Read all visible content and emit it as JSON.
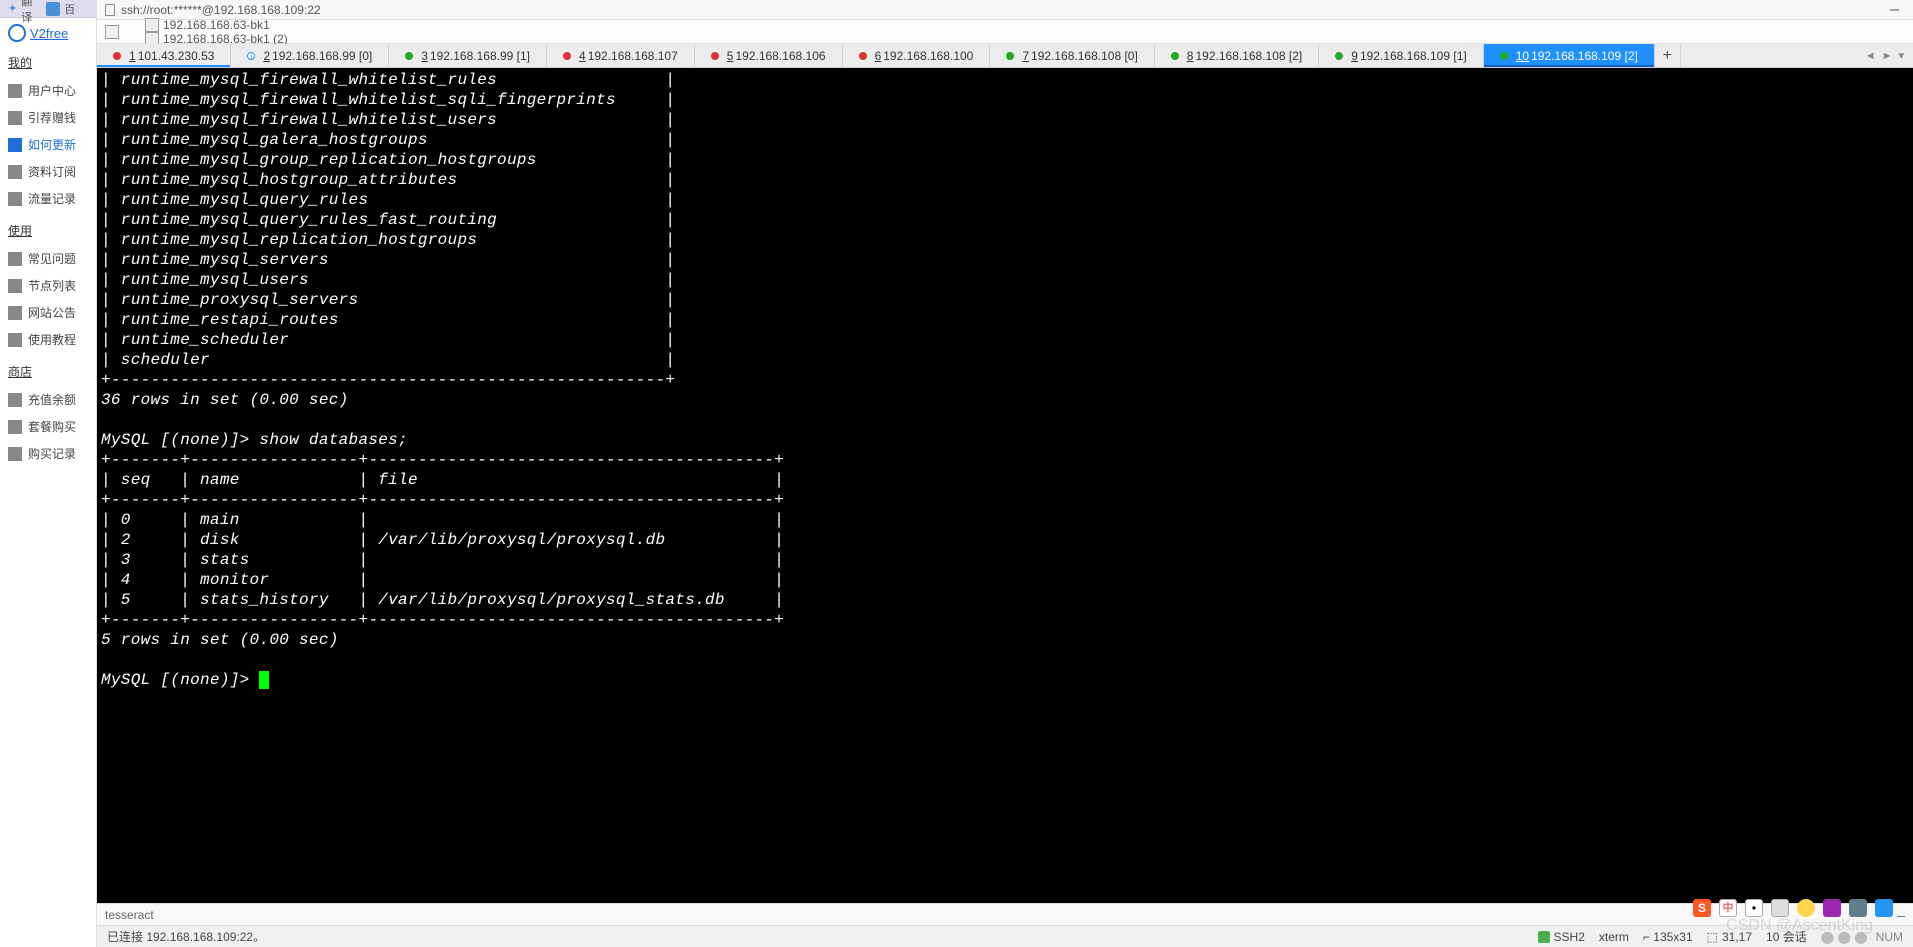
{
  "browser_top": {
    "translate": "翻译",
    "baidu_partial": "百"
  },
  "sidebar": {
    "brand": "V2free",
    "sections": [
      {
        "title": "我的",
        "items": [
          {
            "icon": "user-center-icon",
            "label": "用户中心"
          },
          {
            "icon": "yen-icon",
            "label": "引荐赠钱"
          },
          {
            "icon": "update-icon",
            "label": "如何更新",
            "active": true
          },
          {
            "icon": "subscribe-icon",
            "label": "资料订阅"
          },
          {
            "icon": "traffic-icon",
            "label": "流量记录"
          }
        ]
      },
      {
        "title": "使用",
        "items": [
          {
            "icon": "faq-icon",
            "label": "常见问题"
          },
          {
            "icon": "plane-icon",
            "label": "节点列表"
          },
          {
            "icon": "site-icon",
            "label": "网站公告"
          },
          {
            "icon": "tutorial-icon",
            "label": "使用教程"
          }
        ]
      },
      {
        "title": "商店",
        "items": [
          {
            "icon": "topup-icon",
            "label": "充值余额"
          },
          {
            "icon": "package-icon",
            "label": "套餐购买"
          },
          {
            "icon": "cart-icon",
            "label": "购买记录"
          }
        ]
      }
    ]
  },
  "titlebar": {
    "text": "ssh://root:******@192.168.168.109:22"
  },
  "session_tabs": [
    {
      "icon": "bookmark-icon",
      "label": "192.168.168.63-bk1"
    },
    {
      "icon": "bookmark-icon",
      "label": "192.168.168.63-bk1 (2)"
    }
  ],
  "conn_tabs": [
    {
      "index": "1",
      "label": "101.43.230.53",
      "dot": "#e03030",
      "underline": true
    },
    {
      "index": "2",
      "label": "192.168.168.99 [0]",
      "dot": "#1e90ff",
      "special": "info"
    },
    {
      "index": "3",
      "label": "192.168.168.99 [1]",
      "dot": "#22aa22"
    },
    {
      "index": "4",
      "label": "192.168.168.107",
      "dot": "#e03030"
    },
    {
      "index": "5",
      "label": "192.168.168.106",
      "dot": "#e03030"
    },
    {
      "index": "6",
      "label": "192.168.168.100",
      "dot": "#e03030"
    },
    {
      "index": "7",
      "label": "192.168.168.108 [0]",
      "dot": "#22aa22"
    },
    {
      "index": "8",
      "label": "192.168.168.108 [2]",
      "dot": "#22aa22"
    },
    {
      "index": "9",
      "label": "192.168.168.109 [1]",
      "dot": "#22aa22"
    },
    {
      "index": "10",
      "label": "192.168.168.109 [2]",
      "dot": "#22aa22",
      "active": true
    }
  ],
  "terminal": {
    "table_rows": [
      "runtime_mysql_firewall_whitelist_rules",
      "runtime_mysql_firewall_whitelist_sqli_fingerprints",
      "runtime_mysql_firewall_whitelist_users",
      "runtime_mysql_galera_hostgroups",
      "runtime_mysql_group_replication_hostgroups",
      "runtime_mysql_hostgroup_attributes",
      "runtime_mysql_query_rules",
      "runtime_mysql_query_rules_fast_routing",
      "runtime_mysql_replication_hostgroups",
      "runtime_mysql_servers",
      "runtime_mysql_users",
      "runtime_proxysql_servers",
      "runtime_restapi_routes",
      "runtime_scheduler",
      "scheduler"
    ],
    "rows_footer": "36 rows in set (0.00 sec)",
    "prompt": "MySQL [(none)]>",
    "cmd": "show databases;",
    "db_headers": {
      "seq": "seq",
      "name": "name",
      "file": "file"
    },
    "db_rows": [
      {
        "seq": "0",
        "name": "main",
        "file": ""
      },
      {
        "seq": "2",
        "name": "disk",
        "file": "/var/lib/proxysql/proxysql.db"
      },
      {
        "seq": "3",
        "name": "stats",
        "file": ""
      },
      {
        "seq": "4",
        "name": "monitor",
        "file": ""
      },
      {
        "seq": "5",
        "name": "stats_history",
        "file": "/var/lib/proxysql/proxysql_stats.db"
      }
    ],
    "db_footer": "5 rows in set (0.00 sec)"
  },
  "cmdbar": {
    "text": "tesseract"
  },
  "statusbar": {
    "left": "已连接 192.168.168.109:22。",
    "ssh": "SSH2",
    "term": "xterm",
    "dims_prefix": "⌐",
    "dims": "135x31",
    "pos": "31,17",
    "sessions": "10 会话",
    "caps": "NUM"
  },
  "watermark": "CSDN @AscentKing"
}
